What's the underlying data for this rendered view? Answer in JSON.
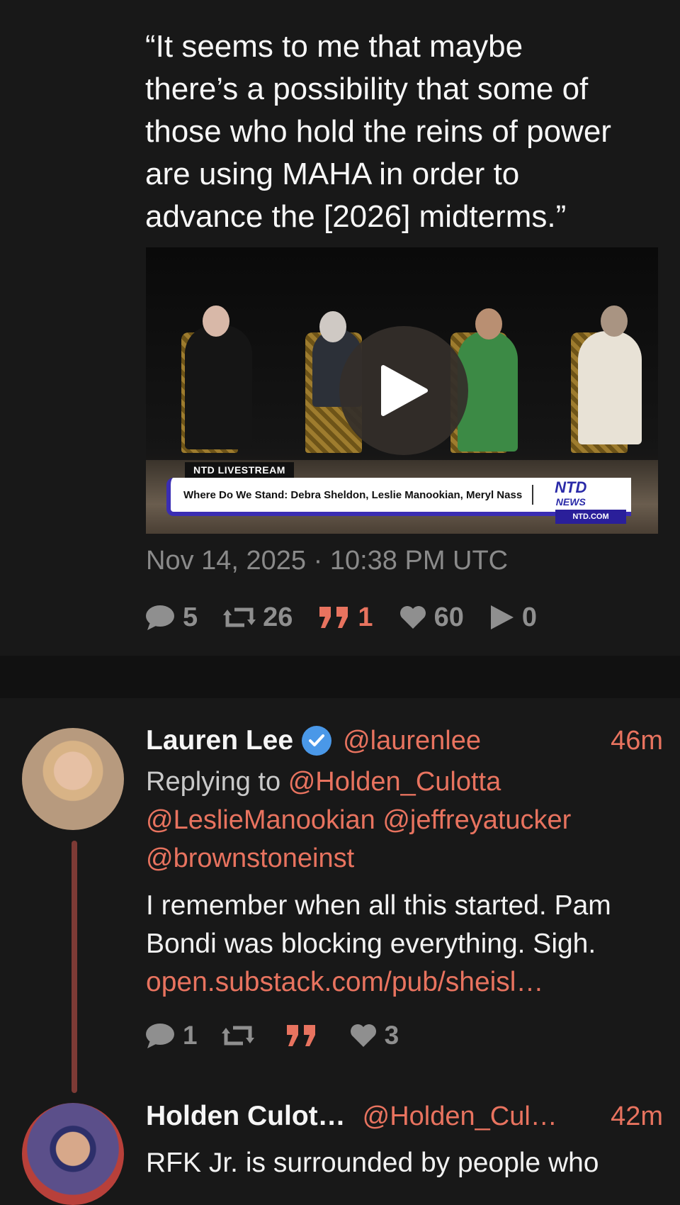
{
  "main_tweet": {
    "quote_lines": [
      "“It seems to me that maybe",
      "there’s a possibility that some of",
      "those who hold the reins of power",
      "are using MAHA in order to",
      "advance the [2026] midterms.”"
    ],
    "video": {
      "tag": "NTD LIVESTREAM",
      "title": "Where Do We Stand: Debra Sheldon, Leslie Manookian, Meryl Nass",
      "logo_top": "NTD",
      "logo_bottom": "NEWS",
      "url": "NTD.COM",
      "play_icon": "play-icon"
    },
    "timestamp": "Nov 14, 2025 · 10:38 PM UTC",
    "stats": {
      "comments": "5",
      "retweets": "26",
      "quotes": "1",
      "likes": "60",
      "plays": "0"
    }
  },
  "replies": [
    {
      "name": "Lauren Lee",
      "verified": true,
      "handle": "@laurenlee",
      "time": "46m",
      "replying_to_label": "Replying to",
      "mentions": [
        "@Holden_Culotta",
        "@LeslieManookian",
        "@jeffreyatucker",
        "@brownstoneinst"
      ],
      "text_lines": [
        "I remember when all this started. Pam",
        "Bondi was blocking everything. Sigh."
      ],
      "link": "open.substack.com/pub/sheisl…",
      "stats": {
        "comments": "1",
        "retweets": "",
        "quotes": "",
        "likes": "3"
      }
    },
    {
      "name": "Holden Culot…",
      "handle": "@Holden_Cul…",
      "time": "42m",
      "text_lines": [
        "RFK Jr. is surrounded by people who"
      ]
    }
  ],
  "colors": {
    "background": "#181818",
    "accent": "#e8735f",
    "muted": "#8f8f8f",
    "verified": "#4a98e8",
    "thread_line": "#7d3a35"
  }
}
